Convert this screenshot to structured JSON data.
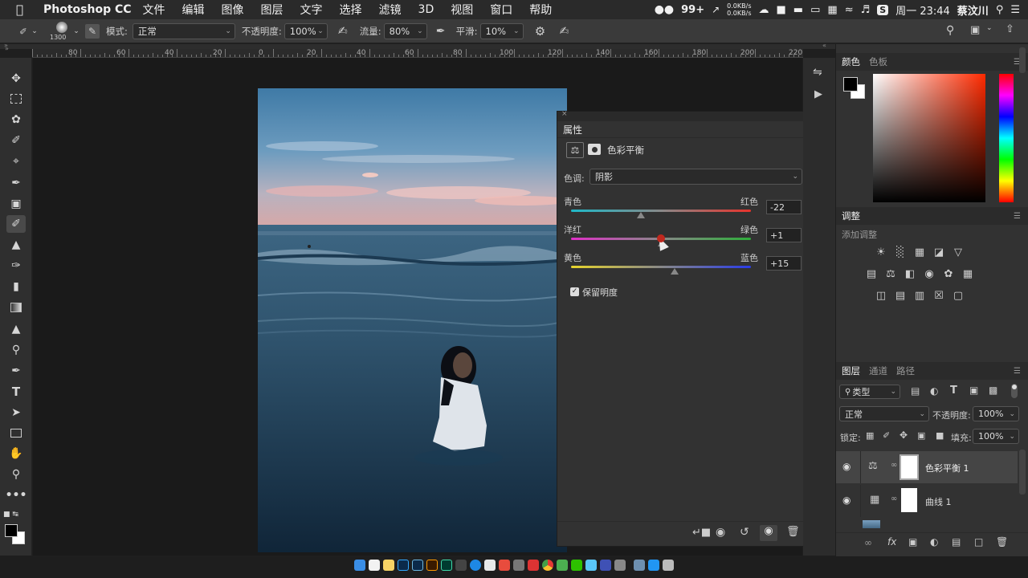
{
  "menubar": {
    "app_name": "Photoshop CC",
    "items": [
      "文件",
      "编辑",
      "图像",
      "图层",
      "文字",
      "选择",
      "滤镜",
      "3D",
      "视图",
      "窗口",
      "帮助"
    ],
    "wechat_count": "99+",
    "net_up": "0.0KB/s",
    "net_down": "0.0KB/s",
    "clock": "周一 23:44",
    "user": "蔡汶川"
  },
  "options": {
    "brush_size": "1300",
    "mode_label": "模式:",
    "mode_value": "正常",
    "opacity_label": "不透明度:",
    "opacity_value": "100%",
    "flow_label": "流量:",
    "flow_value": "80%",
    "smooth_label": "平滑:",
    "smooth_value": "10%"
  },
  "ruler": {
    "labels": [
      "80",
      "60",
      "40",
      "20",
      "0",
      "20",
      "40",
      "60",
      "80",
      "100",
      "120",
      "140",
      "160",
      "180",
      "200",
      "220"
    ]
  },
  "properties": {
    "title": "属性",
    "section": "色彩平衡",
    "tone_label": "色调:",
    "tone_value": "阴影",
    "sliders": [
      {
        "left": "青色",
        "right": "红色",
        "value": "-22",
        "fraction": 0.39
      },
      {
        "left": "洋红",
        "right": "绿色",
        "value": "+1",
        "fraction": 0.505
      },
      {
        "left": "黄色",
        "right": "蓝色",
        "value": "+15",
        "fraction": 0.575
      }
    ],
    "preserve_label": "保留明度",
    "preserve_checked": true
  },
  "color_panel": {
    "tabs": [
      "颜色",
      "色板"
    ],
    "hue_color": "#ff2a00"
  },
  "adjust_panel": {
    "title": "调整",
    "subtitle": "添加调整"
  },
  "layers_panel": {
    "tabs": [
      "图层",
      "通道",
      "路径"
    ],
    "filter_label": "类型",
    "blend_value": "正常",
    "opacity_label": "不透明度:",
    "opacity_value": "100%",
    "lock_label": "锁定:",
    "fill_label": "填充:",
    "fill_value": "100%",
    "layers": [
      {
        "name": "色彩平衡 1",
        "icon": "balance-icon",
        "selected": true
      },
      {
        "name": "曲线 1",
        "icon": "curves-icon",
        "selected": false
      }
    ]
  }
}
